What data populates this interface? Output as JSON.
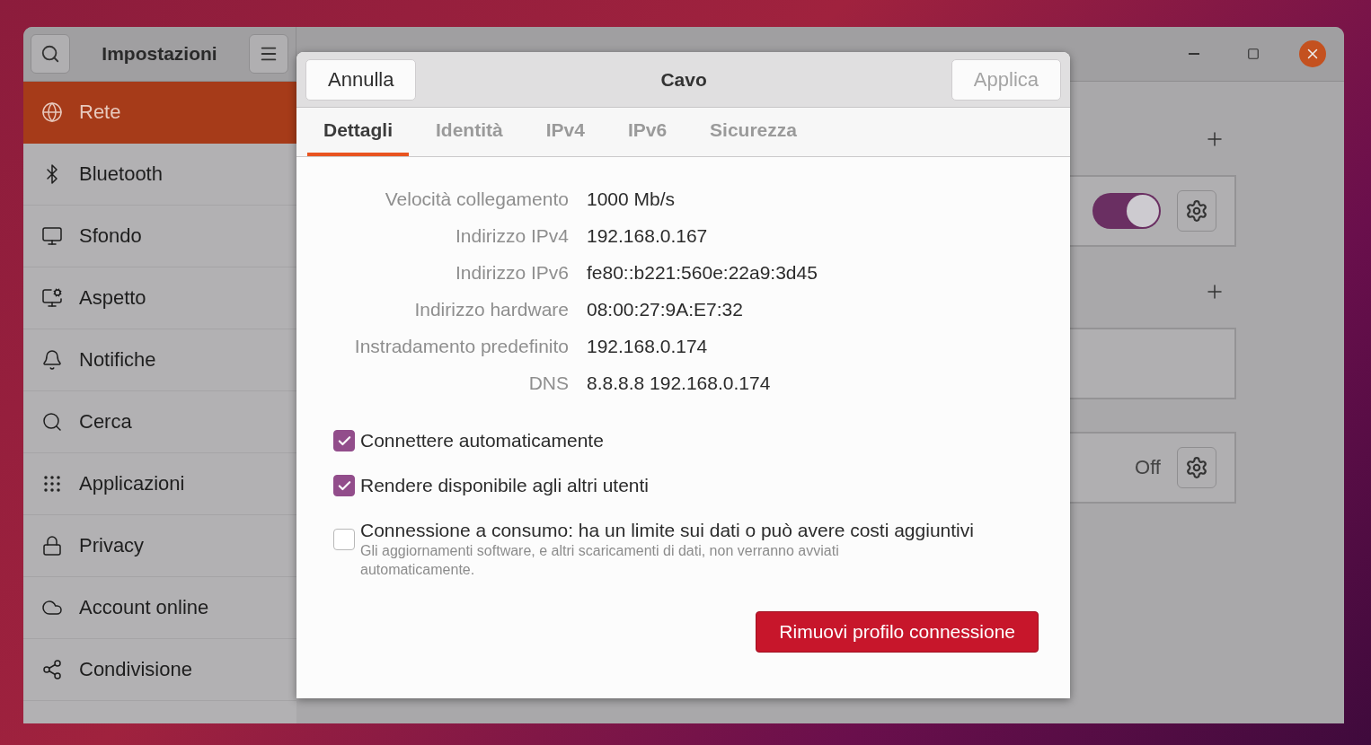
{
  "window": {
    "title": "Impostazioni"
  },
  "sidebar": {
    "items": [
      {
        "label": "Rete",
        "selected": true
      },
      {
        "label": "Bluetooth",
        "selected": false
      },
      {
        "label": "Sfondo",
        "selected": false
      },
      {
        "label": "Aspetto",
        "selected": false
      },
      {
        "label": "Notifiche",
        "selected": false
      },
      {
        "label": "Cerca",
        "selected": false
      },
      {
        "label": "Applicazioni",
        "selected": false
      },
      {
        "label": "Privacy",
        "selected": false
      },
      {
        "label": "Account online",
        "selected": false
      },
      {
        "label": "Condivisione",
        "selected": false
      }
    ]
  },
  "network_panel": {
    "cards": [
      {
        "kind": "switch",
        "on": true
      },
      {
        "kind": "empty"
      },
      {
        "kind": "status",
        "status": "Off"
      }
    ]
  },
  "dialog": {
    "title": "Cavo",
    "cancel": "Annulla",
    "apply": {
      "label": "Applica",
      "disabled": true
    },
    "tabs": [
      {
        "label": "Dettagli",
        "selected": true
      },
      {
        "label": "Identità",
        "selected": false
      },
      {
        "label": "IPv4",
        "selected": false
      },
      {
        "label": "IPv6",
        "selected": false
      },
      {
        "label": "Sicurezza",
        "selected": false
      }
    ],
    "details": [
      {
        "label": "Velocità collegamento",
        "value": "1000 Mb/s"
      },
      {
        "label": "Indirizzo IPv4",
        "value": "192.168.0.167"
      },
      {
        "label": "Indirizzo IPv6",
        "value": "fe80::b221:560e:22a9:3d45"
      },
      {
        "label": "Indirizzo hardware",
        "value": "08:00:27:9A:E7:32"
      },
      {
        "label": "Instradamento predefinito",
        "value": "192.168.0.174"
      },
      {
        "label": "DNS",
        "value": "8.8.8.8 192.168.0.174"
      }
    ],
    "options": [
      {
        "label": "Connettere automaticamente",
        "checked": true
      },
      {
        "label": "Rendere disponibile agli altri utenti",
        "checked": true
      },
      {
        "label": "Connessione a consumo: ha un limite sui dati o può avere costi aggiuntivi",
        "description": "Gli aggiornamenti software, e altri scaricamenti di dati, non verranno avviati automaticamente.",
        "checked": false
      }
    ],
    "remove_button": "Rimuovi profilo connessione"
  }
}
